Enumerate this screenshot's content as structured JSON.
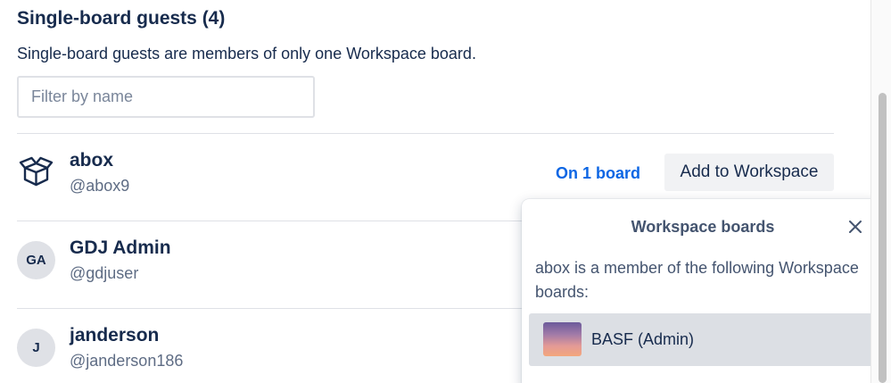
{
  "section": {
    "title": "Single-board guests (4)",
    "description": "Single-board guests are members of only one Workspace board."
  },
  "filter": {
    "placeholder": "Filter by name",
    "value": ""
  },
  "members": [
    {
      "name": "abox",
      "handle": "@abox9",
      "avatar_type": "box-icon",
      "boards_label": "On 1 board",
      "action_label": "Add to Workspace"
    },
    {
      "name": "GDJ Admin",
      "handle": "@gdjuser",
      "avatar_initials": "GA"
    },
    {
      "name": "janderson",
      "handle": "@janderson186",
      "avatar_initials": "J"
    }
  ],
  "popover": {
    "title": "Workspace boards",
    "close_icon": "close-icon",
    "text": "abox is a member of the following Workspace boards:",
    "boards": [
      {
        "name": "BASF (Admin)"
      }
    ]
  },
  "colors": {
    "link": "#0c66e4",
    "text": "#172b4d",
    "muted": "#5e6c84",
    "button_bg": "#f1f2f4",
    "board_item_bg": "#dcdfe4"
  }
}
